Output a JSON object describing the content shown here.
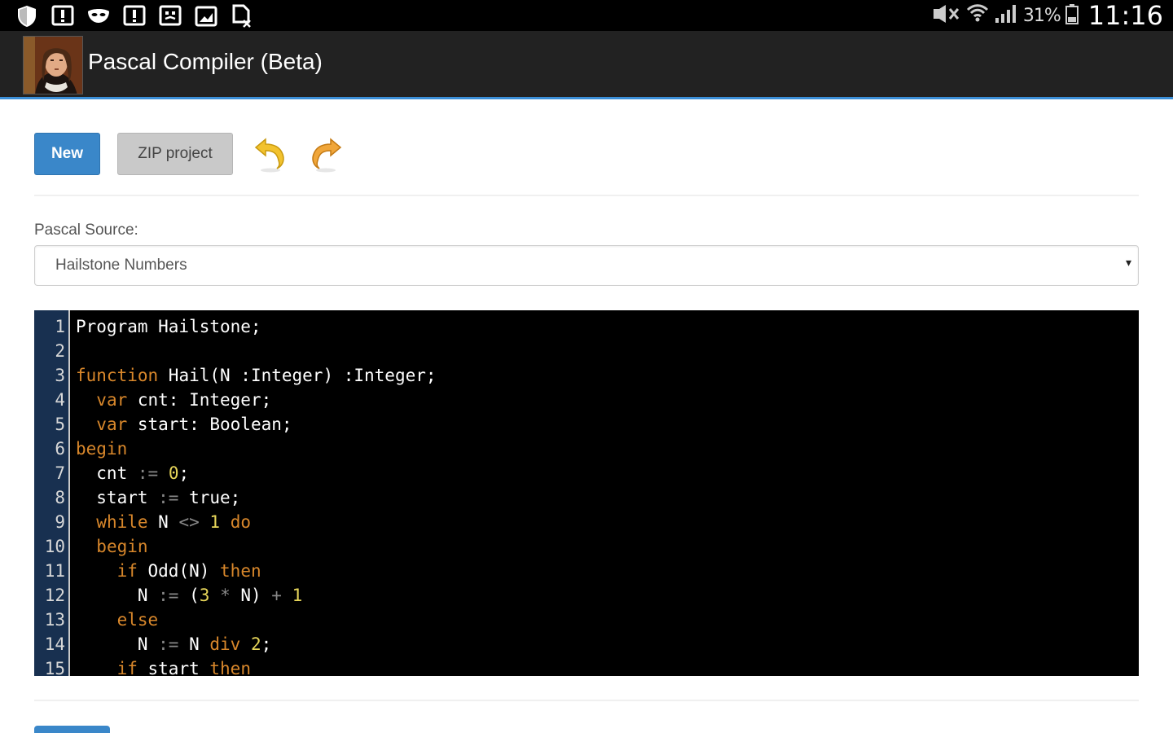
{
  "status_bar": {
    "icons": [
      "shield-icon",
      "alert-icon",
      "mask-icon",
      "alert-icon",
      "face-icon",
      "image-icon",
      "document-icon"
    ],
    "battery_text": "31%",
    "time": "11:16"
  },
  "app": {
    "title": "Pascal Compiler (Beta)",
    "accent_color": "#3b8fd8"
  },
  "toolbar": {
    "new_label": "New",
    "zip_label": "ZIP project",
    "undo_icon": "undo-icon",
    "redo_icon": "redo-icon"
  },
  "source": {
    "label": "Pascal Source:",
    "selected": "Hailstone Numbers"
  },
  "editor": {
    "line_numbers": [
      "1",
      "2",
      "3",
      "4",
      "5",
      "6",
      "7",
      "8",
      "9",
      "10",
      "11",
      "12",
      "13",
      "14",
      "15"
    ],
    "lines": [
      [
        {
          "t": "Program Hailstone;",
          "c": "plain"
        }
      ],
      [],
      [
        {
          "t": "function",
          "c": "kw"
        },
        {
          "t": " Hail(N :Integer) :Integer;",
          "c": "plain"
        }
      ],
      [
        {
          "t": "  ",
          "c": "plain"
        },
        {
          "t": "var",
          "c": "kw"
        },
        {
          "t": " cnt: Integer;",
          "c": "plain"
        }
      ],
      [
        {
          "t": "  ",
          "c": "plain"
        },
        {
          "t": "var",
          "c": "kw"
        },
        {
          "t": " start: Boolean;",
          "c": "plain"
        }
      ],
      [
        {
          "t": "begin",
          "c": "kw"
        }
      ],
      [
        {
          "t": "  cnt ",
          "c": "plain"
        },
        {
          "t": ":=",
          "c": "op"
        },
        {
          "t": " ",
          "c": "plain"
        },
        {
          "t": "0",
          "c": "num"
        },
        {
          "t": ";",
          "c": "plain"
        }
      ],
      [
        {
          "t": "  start ",
          "c": "plain"
        },
        {
          "t": ":=",
          "c": "op"
        },
        {
          "t": " true;",
          "c": "plain"
        }
      ],
      [
        {
          "t": "  ",
          "c": "plain"
        },
        {
          "t": "while",
          "c": "kw"
        },
        {
          "t": " N ",
          "c": "plain"
        },
        {
          "t": "<>",
          "c": "op"
        },
        {
          "t": " ",
          "c": "plain"
        },
        {
          "t": "1",
          "c": "num"
        },
        {
          "t": " ",
          "c": "plain"
        },
        {
          "t": "do",
          "c": "kw"
        }
      ],
      [
        {
          "t": "  ",
          "c": "plain"
        },
        {
          "t": "begin",
          "c": "kw"
        }
      ],
      [
        {
          "t": "    ",
          "c": "plain"
        },
        {
          "t": "if",
          "c": "kw"
        },
        {
          "t": " Odd(N) ",
          "c": "plain"
        },
        {
          "t": "then",
          "c": "kw"
        }
      ],
      [
        {
          "t": "      N ",
          "c": "plain"
        },
        {
          "t": ":=",
          "c": "op"
        },
        {
          "t": " (",
          "c": "plain"
        },
        {
          "t": "3",
          "c": "num"
        },
        {
          "t": " ",
          "c": "plain"
        },
        {
          "t": "*",
          "c": "op"
        },
        {
          "t": " N) ",
          "c": "plain"
        },
        {
          "t": "+",
          "c": "op"
        },
        {
          "t": " ",
          "c": "plain"
        },
        {
          "t": "1",
          "c": "num"
        }
      ],
      [
        {
          "t": "    ",
          "c": "plain"
        },
        {
          "t": "else",
          "c": "kw"
        }
      ],
      [
        {
          "t": "      N ",
          "c": "plain"
        },
        {
          "t": ":=",
          "c": "op"
        },
        {
          "t": " N ",
          "c": "plain"
        },
        {
          "t": "div",
          "c": "kw"
        },
        {
          "t": " ",
          "c": "plain"
        },
        {
          "t": "2",
          "c": "num"
        },
        {
          "t": ";",
          "c": "plain"
        }
      ],
      [
        {
          "t": "    ",
          "c": "plain"
        },
        {
          "t": "if",
          "c": "kw"
        },
        {
          "t": " start ",
          "c": "plain"
        },
        {
          "t": "then",
          "c": "kw"
        }
      ]
    ]
  }
}
